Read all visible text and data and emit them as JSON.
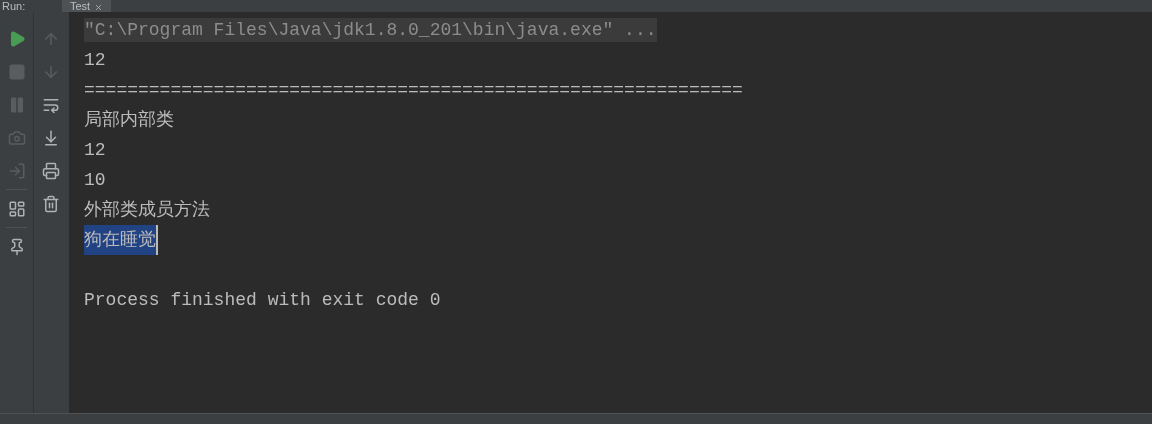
{
  "header": {
    "title": "Run:",
    "tab": "Test"
  },
  "lines": [
    {
      "kind": "command",
      "text": "\"C:\\Program Files\\Java\\jdk1.8.0_201\\bin\\java.exe\" ..."
    },
    {
      "kind": "output",
      "text": "12",
      "selected": false
    },
    {
      "kind": "output",
      "text": "=============================================================",
      "selected": false
    },
    {
      "kind": "output",
      "text": "局部内部类",
      "selected": false
    },
    {
      "kind": "output",
      "text": "12",
      "selected": false
    },
    {
      "kind": "output",
      "text": "10",
      "selected": false
    },
    {
      "kind": "output",
      "text": "外部类成员方法",
      "selected": false
    },
    {
      "kind": "output",
      "text": "狗在睡觉",
      "selected": true
    },
    {
      "kind": "blank"
    },
    {
      "kind": "output",
      "text": "Process finished with exit code 0",
      "selected": false
    }
  ]
}
